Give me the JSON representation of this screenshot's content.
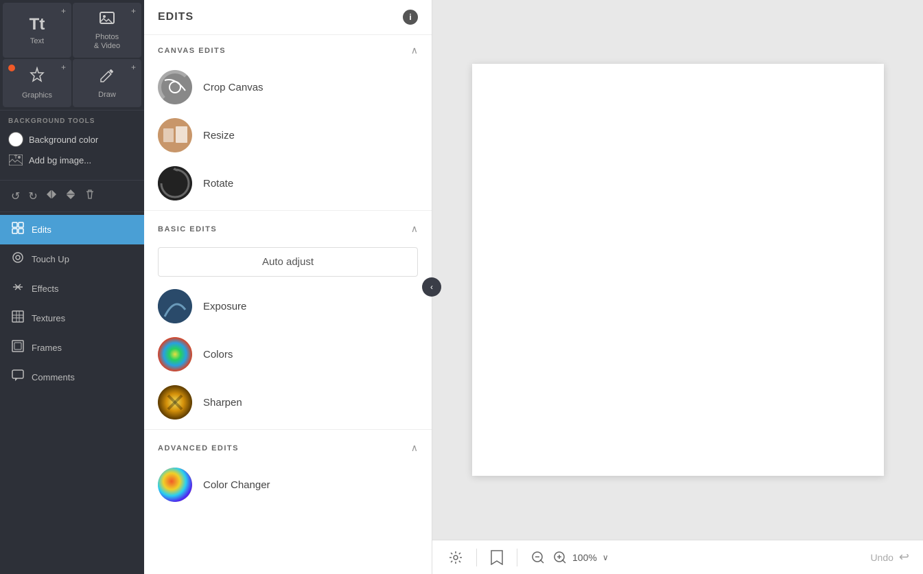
{
  "leftToolbar": {
    "tools": [
      {
        "id": "text",
        "label": "Text",
        "icon": "T",
        "hasPlus": true,
        "hasDot": false
      },
      {
        "id": "photos-video",
        "label": "Photos\n& Video",
        "icon": "📷",
        "hasPlus": true,
        "hasDot": false
      },
      {
        "id": "graphics",
        "label": "Graphics",
        "icon": "✦",
        "hasPlus": true,
        "hasDot": true
      },
      {
        "id": "draw",
        "label": "Draw",
        "icon": "✏️",
        "hasPlus": true,
        "hasDot": false
      }
    ],
    "backgroundTools": {
      "label": "BACKGROUND TOOLS",
      "bgColor": {
        "label": "Background color"
      },
      "bgImage": {
        "label": "Add bg image..."
      }
    },
    "navItems": [
      {
        "id": "edits",
        "label": "Edits",
        "icon": "⊞",
        "active": true
      },
      {
        "id": "touch-up",
        "label": "Touch Up",
        "icon": "◎"
      },
      {
        "id": "effects",
        "label": "Effects",
        "icon": "✦"
      },
      {
        "id": "textures",
        "label": "Textures",
        "icon": "⊞"
      },
      {
        "id": "frames",
        "label": "Frames",
        "icon": "▣"
      },
      {
        "id": "comments",
        "label": "Comments",
        "icon": "💬"
      }
    ]
  },
  "editsPanel": {
    "title": "EDITS",
    "infoIcon": "i",
    "collapseIcon": "‹",
    "sections": [
      {
        "id": "canvas-edits",
        "label": "CANVAS EDITS",
        "collapsed": false,
        "items": [
          {
            "id": "crop",
            "label": "Crop Canvas"
          },
          {
            "id": "resize",
            "label": "Resize"
          },
          {
            "id": "rotate",
            "label": "Rotate"
          }
        ]
      },
      {
        "id": "basic-edits",
        "label": "BASIC EDITS",
        "collapsed": false,
        "autoAdjust": "Auto adjust",
        "items": [
          {
            "id": "exposure",
            "label": "Exposure"
          },
          {
            "id": "colors",
            "label": "Colors"
          },
          {
            "id": "sharpen",
            "label": "Sharpen"
          }
        ]
      },
      {
        "id": "advanced-edits",
        "label": "ADVANCED EDITS",
        "collapsed": false,
        "items": [
          {
            "id": "color-changer",
            "label": "Color Changer"
          }
        ]
      }
    ]
  },
  "bottomBar": {
    "zoomValue": "100%",
    "undoLabel": "Undo"
  }
}
